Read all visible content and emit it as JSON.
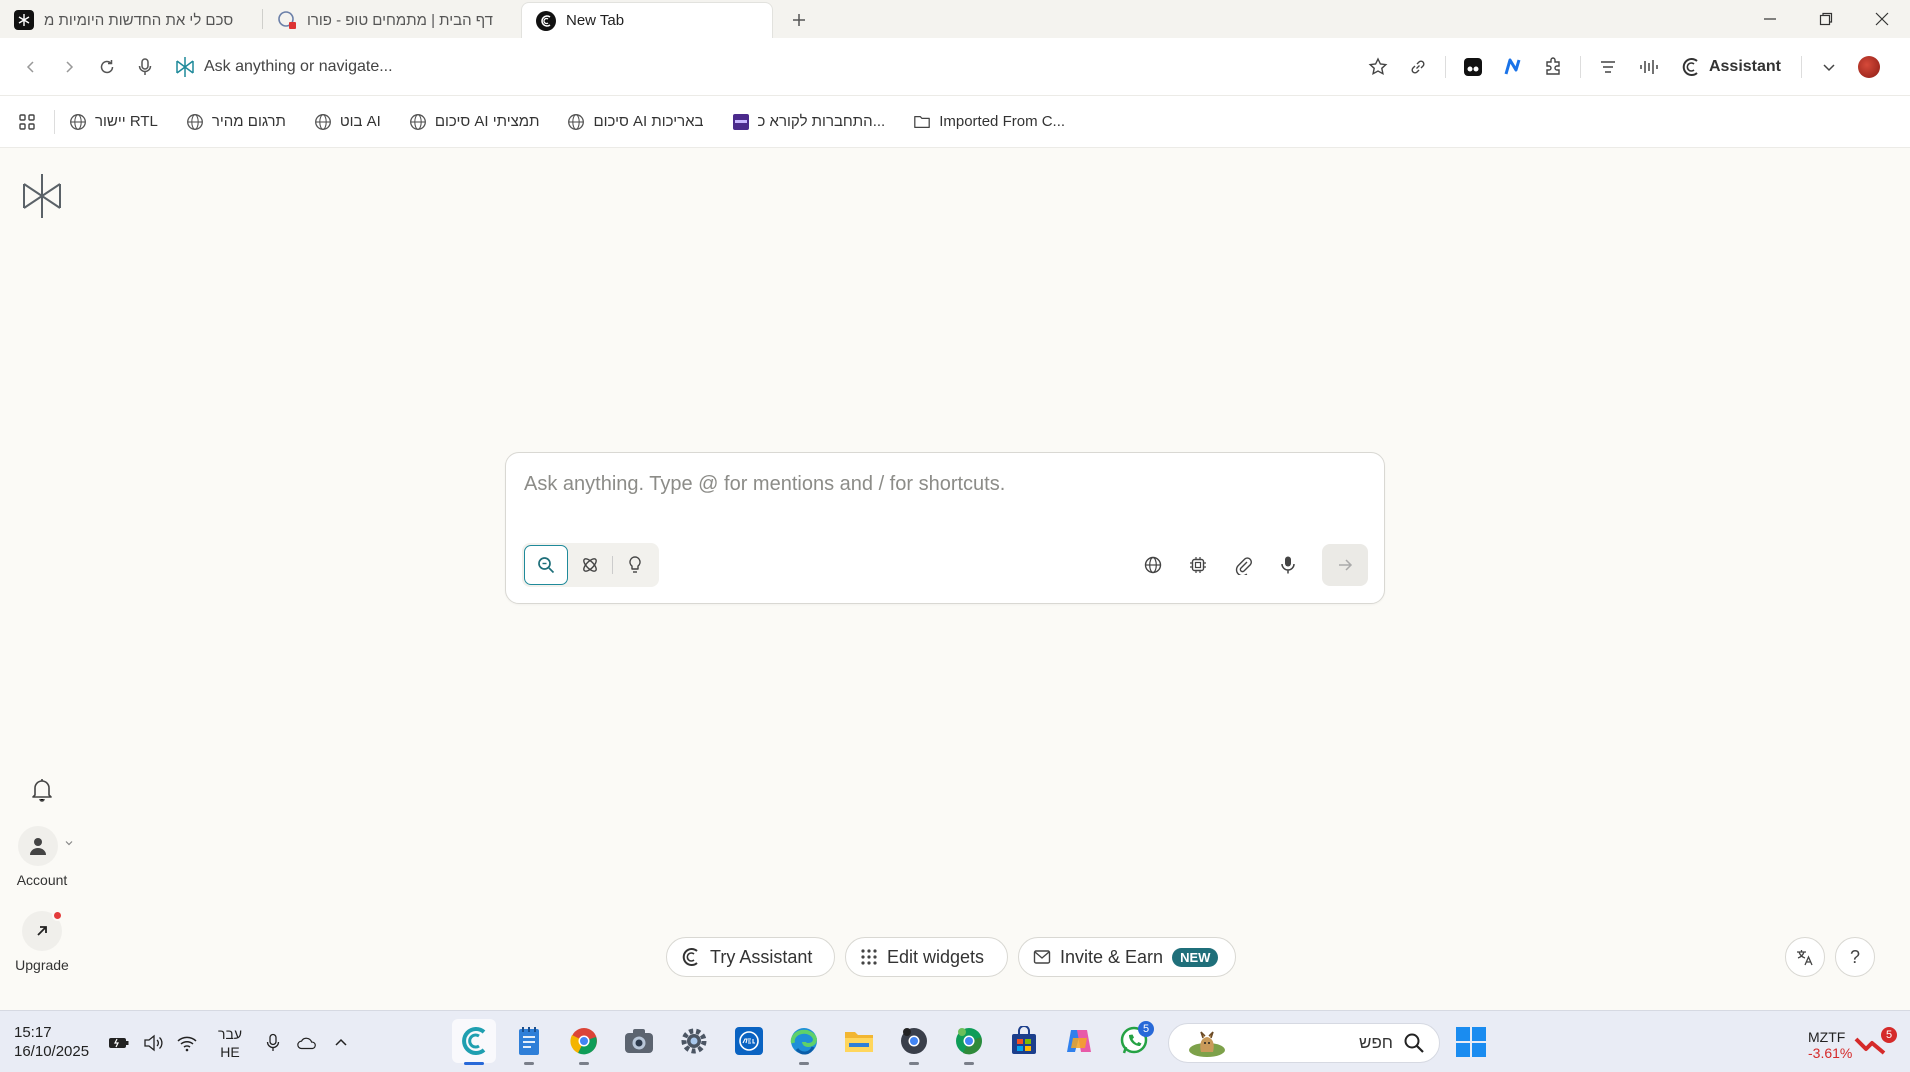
{
  "tabs": [
    {
      "title": "סכם לי את החדשות היומיות מ",
      "active": false
    },
    {
      "title": "דף הבית | מתמחים טופ - פורו",
      "active": false
    },
    {
      "title": "New Tab",
      "active": true
    }
  ],
  "address_bar": {
    "placeholder": "Ask anything or navigate...",
    "assistant_label": "Assistant"
  },
  "bookmarks": {
    "items": [
      {
        "label": "יישור RTL",
        "icon": "globe-icon"
      },
      {
        "label": "תרגום מהיר",
        "icon": "globe-icon"
      },
      {
        "label": "בוט AI",
        "icon": "globe-icon"
      },
      {
        "label": "סיכום AI תמציתי",
        "icon": "globe-icon"
      },
      {
        "label": "סיכום AI באריכות",
        "icon": "globe-icon"
      },
      {
        "label": "התחברות לקורא כ...",
        "icon": "app-icon"
      },
      {
        "label": "Imported From C...",
        "icon": "folder-icon"
      }
    ]
  },
  "sidebar": {
    "account_label": "Account",
    "upgrade_label": "Upgrade"
  },
  "search": {
    "placeholder": "Ask anything. Type @ for mentions and / for shortcuts."
  },
  "bottom_actions": {
    "try_assistant": "Try Assistant",
    "edit_widgets": "Edit widgets",
    "invite_earn": "Invite & Earn",
    "new_badge": "NEW",
    "help": "?"
  },
  "taskbar": {
    "time": "15:17",
    "date": "16/10/2025",
    "lang_top": "עבר",
    "lang_bottom": "HE",
    "search_text": "חפש",
    "whatsapp_badge": "5",
    "ticker_symbol": "MZTF",
    "ticker_change": "-3.61%",
    "stock_badge": "5"
  },
  "colors": {
    "accent": "#1f8a9a",
    "badge": "#1f6f7a",
    "page_bg": "#fbfaf6"
  }
}
